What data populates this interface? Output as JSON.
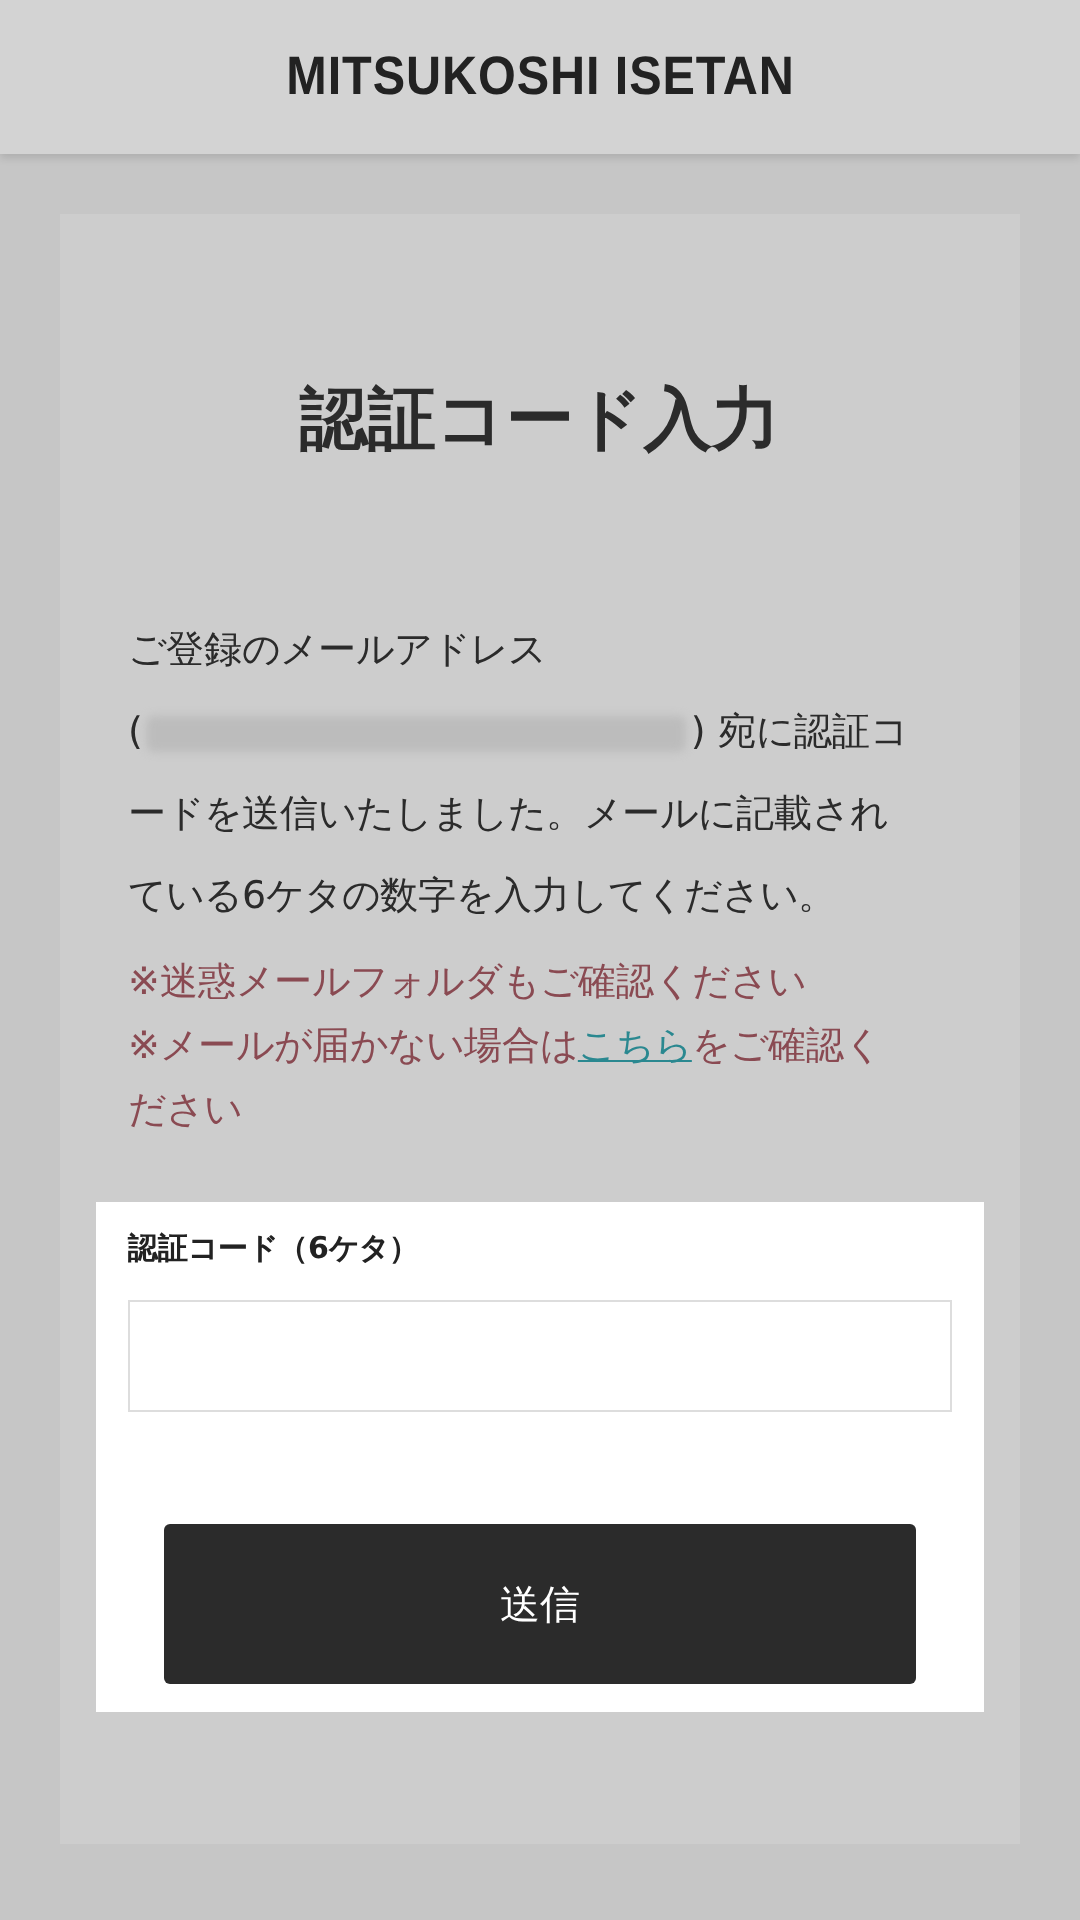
{
  "header": {
    "logo": "MITSUKOSHI ISETAN"
  },
  "title": "認証コード入力",
  "message": {
    "before": "ご登録のメールアドレス",
    "open": "(",
    "after": ") 宛に認証コ",
    "rest": "ードを送信いたしました。メールに記載されている6ケタの数字を入力してください。"
  },
  "notes": [
    {
      "text": "※迷惑メールフォルダもご確認ください"
    },
    {
      "before": "※メールが届かない場合は",
      "link": "こちら",
      "after": "をご確認ください"
    }
  ],
  "form": {
    "label": "認証コード（6ケタ）",
    "submit": "送信"
  }
}
